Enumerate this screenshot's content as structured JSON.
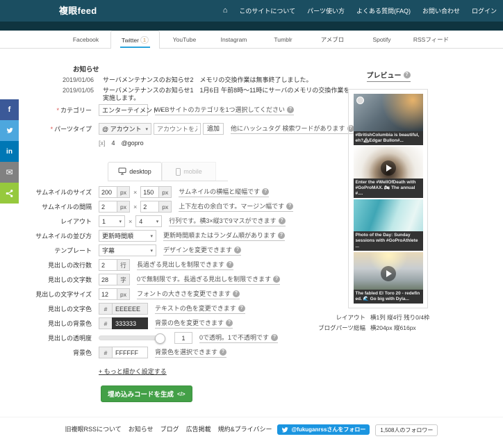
{
  "navbar": {
    "brand": "複眼feed",
    "home_icon": "⌂",
    "items": [
      "このサイトについて",
      "パーツ使い方",
      "よくある質問(FAQ)",
      "お問い合わせ",
      "ログイン"
    ]
  },
  "tabs": [
    {
      "label": "Facebook"
    },
    {
      "label": "Twitter",
      "badge": "1"
    },
    {
      "label": "YouTube"
    },
    {
      "label": "Instagram"
    },
    {
      "label": "Tumblr"
    },
    {
      "label": "アメブロ"
    },
    {
      "label": "Spotify"
    },
    {
      "label": "RSSフィード"
    }
  ],
  "share_rail": {
    "facebook": "f",
    "linkedin": "in",
    "email": "✉"
  },
  "notices": {
    "title": "お知らせ",
    "items": [
      {
        "date": "2019/01/06",
        "text": "サーバメンテナンスのお知らせ2　メモリの交換作業は無事終了しました。"
      },
      {
        "date": "2019/01/05",
        "text": "サーバメンテナンスのお知らせ1　1月6日 午前8時〜11時にサーバのメモリの交換作業を実施します。"
      }
    ]
  },
  "icons": {
    "caret": "▾",
    "times": "×",
    "info": "?",
    "hash": "#",
    "plus_minus": "[x]"
  },
  "form": {
    "required_mark": "*",
    "category": {
      "label": "カテゴリー",
      "value": "エンターテイメント",
      "help": "WEBサイトのカテゴリを1つ選択してください"
    },
    "parts": {
      "label": "パーツタイプ",
      "value": "@ アカウント",
      "placeholder": "アカウントを入力",
      "add": "追加",
      "help": "他にハッシュタグ 検索ワードがあります"
    },
    "account": {
      "remove": "[x]",
      "count": "4",
      "name": "@gopro"
    },
    "device_tabs": {
      "desktop": "desktop",
      "mobile": "mobile"
    },
    "thumb_size": {
      "label": "サムネイルのサイズ",
      "w": "200",
      "h": "150",
      "unit": "px",
      "help": "サムネイルの横幅と縦幅です"
    },
    "thumb_gap": {
      "label": "サムネイルの間隔",
      "w": "2",
      "h": "2",
      "unit": "px",
      "help": "上下左右の余白です。マージン幅です"
    },
    "layout": {
      "label": "レイアウト",
      "cols": "1",
      "rows": "4",
      "help": "行列です。横3×縦3で9マスができます"
    },
    "sort": {
      "label": "サムネイルの並び方",
      "value": "更新時間順",
      "help": "更新時間順またはランダム順があります"
    },
    "template": {
      "label": "テンプレート",
      "value": "字幕",
      "help": "デザインを変更できます"
    },
    "line_count": {
      "label": "見出しの改行数",
      "value": "2",
      "unit": "行",
      "help": "長過ぎる見出しを制限できます"
    },
    "char_count": {
      "label": "見出しの文字数",
      "value": "28",
      "unit": "字",
      "help": "0で無制限です。長過ぎる見出しを制限できます"
    },
    "font_size": {
      "label": "見出しの文字サイズ",
      "value": "12",
      "unit": "px",
      "help": "フォントの大きさを変更できます"
    },
    "text_color": {
      "label": "見出しの文字色",
      "prefix": "#",
      "value": "EEEEEE",
      "help": "テキストの色を変更できます"
    },
    "head_bg": {
      "label": "見出しの背景色",
      "prefix": "#",
      "value": "333333",
      "help": "背景の色を変更できます"
    },
    "opacity": {
      "label": "見出しの透明度",
      "value": "1",
      "help": "0で透明。1で不透明です"
    },
    "bg_color": {
      "label": "背景色",
      "prefix": "#",
      "value": "FFFFFF",
      "help": "背景色を選択できます"
    },
    "more_link": "+ もっと細かく設定する",
    "generate": {
      "label": "埋め込みコードを生成",
      "icon": "</>"
    }
  },
  "preview": {
    "title": "プレビュー",
    "thumbnails": [
      {
        "caption": "#BritishColumbia is beautiful, eh?🏔Edgar Bullon#...",
        "has_play": false
      },
      {
        "caption": "Enter the #WellOfDeath with #GoProMAX. 🏍 The annual #....",
        "has_play": true
      },
      {
        "caption": "Photo of the Day: Sunday sessions with #GoProAthlete ...",
        "has_play": false
      },
      {
        "caption": "The fabled El Toro 20 - redefin ed. 🌊 Go big with Dyla...",
        "has_play": true
      }
    ],
    "info": [
      {
        "label": "レイアウト",
        "value": "横1列 縦4行 残り0/4枠"
      },
      {
        "label": "ブログパーツ総幅",
        "value": "横204px 縦616px"
      }
    ]
  },
  "footer": {
    "links": [
      "旧複眼RSSについて",
      "お知らせ",
      "ブログ",
      "広告掲載",
      "規約&プライバシー"
    ],
    "follow": "@fukuganrssさんをフォロー",
    "followers": "1,508人のフォロワー"
  },
  "colors": {
    "navbar": "#1B4E61",
    "subbar": "#0F3440",
    "tab_underline": "#2AA3DC",
    "button_green": "#43A047",
    "twitter_blue": "#1B95E0",
    "heading_bg": "#333333",
    "heading_text": "#EEEEEE"
  }
}
